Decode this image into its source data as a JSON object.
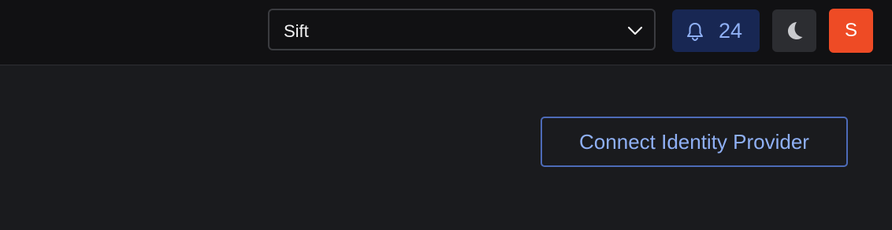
{
  "header": {
    "org_select": {
      "value": "Sift"
    },
    "notifications": {
      "count": "24"
    },
    "avatar": {
      "initial": "S"
    }
  },
  "main": {
    "connect_button_label": "Connect Identity Provider"
  },
  "icons": {
    "chevron": "chevron-down-icon",
    "bell": "bell-icon",
    "theme": "moon-icon"
  },
  "colors": {
    "topbar_bg": "#111113",
    "page_bg": "#1a1b1e",
    "notification_bg": "#182753",
    "accent_text": "#8fb0f5",
    "avatar_bg": "#ee4b25",
    "button_border": "#4d6bb8"
  }
}
